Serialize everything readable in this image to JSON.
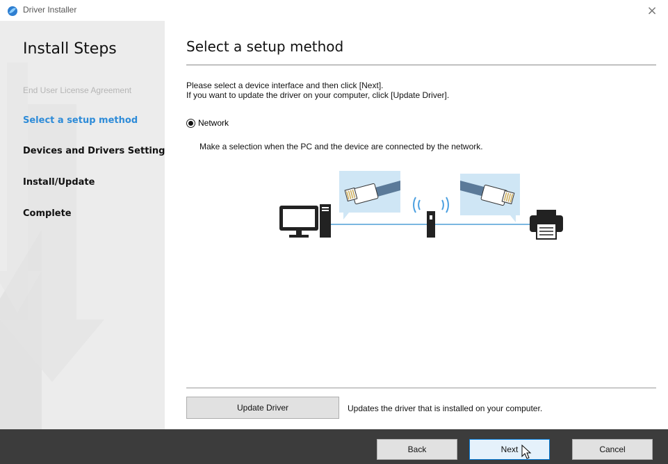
{
  "window": {
    "title": "Driver Installer",
    "close_glyph": "×"
  },
  "sidebar": {
    "heading": "Install Steps",
    "steps": [
      {
        "label": "End User License Agreement",
        "state": "done"
      },
      {
        "label": "Select a setup method",
        "state": "current"
      },
      {
        "label": "Devices and Drivers Settings",
        "state": "pending"
      },
      {
        "label": "Install/Update",
        "state": "pending"
      },
      {
        "label": "Complete",
        "state": "pending"
      }
    ]
  },
  "main": {
    "title": "Select a setup method",
    "instructions": [
      "Please select a device interface and then click [Next].",
      "If you want to update the driver on your computer, click [Update Driver]."
    ],
    "option": {
      "label": "Network",
      "selected": true,
      "description": "Make a selection when the PC and the device are connected by the network."
    },
    "update_driver": {
      "button_label": "Update Driver",
      "description": "Updates the driver that is installed on your computer."
    }
  },
  "footer": {
    "back_label": "Back",
    "next_label": "Next",
    "cancel_label": "Cancel"
  },
  "colors": {
    "accent": "#2d8bd8",
    "sidebar_bg": "#ececec",
    "footer_bg": "#3c3c3c",
    "diagram_bubble": "#cfe6f5",
    "cable": "#5b7a99"
  },
  "icons": [
    "app-icon",
    "close-icon",
    "monitor-icon",
    "pc-tower-icon",
    "ethernet-plug-icon",
    "wifi-router-icon",
    "printer-icon",
    "cursor-icon"
  ]
}
